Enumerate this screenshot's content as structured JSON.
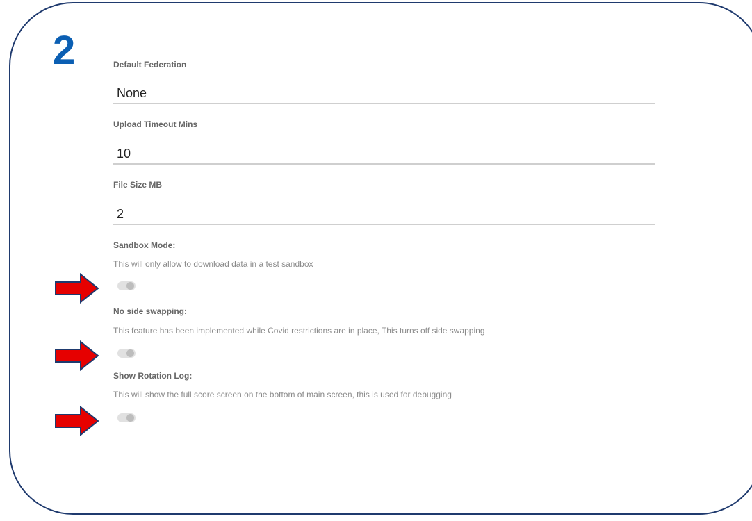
{
  "step_number": "2",
  "fields": [
    {
      "label": "Default Federation",
      "value": "None"
    },
    {
      "label": "Upload Timeout Mins",
      "value": "10"
    },
    {
      "label": "File Size MB",
      "value": "2"
    }
  ],
  "toggles": [
    {
      "title": "Sandbox Mode:",
      "description": "This will only allow to download data in a test sandbox",
      "checked": false
    },
    {
      "title": "No side swapping:",
      "description": "This feature has been implemented while Covid restrictions are in place, This turns off side swapping",
      "checked": false
    },
    {
      "title": "Show Rotation Log:",
      "description": "This will show the full score screen on the bottom of main screen, this is used for debugging",
      "checked": false
    }
  ],
  "colors": {
    "frame_border": "#1f3a6e",
    "step_number": "#0b5fb3",
    "arrow_fill": "#e60000",
    "arrow_stroke": "#1f3a6e"
  },
  "icons": {
    "arrow": "red-right-arrow-icon"
  }
}
